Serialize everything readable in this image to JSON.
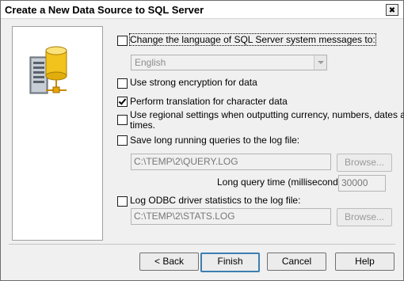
{
  "window": {
    "title": "Create a New Data Source to SQL Server",
    "close_glyph": "✖"
  },
  "options": {
    "change_language": {
      "label": "Change the language of SQL Server system messages to:",
      "checked": false
    },
    "language_select": {
      "value": "English",
      "enabled": false
    },
    "strong_encryption": {
      "label": "Use strong encryption for data",
      "checked": false
    },
    "perform_translation": {
      "label": "Perform translation for character data",
      "checked": true
    },
    "regional_settings": {
      "label_line1": "Use regional settings when outputting currency, numbers, dates and",
      "label_line2": "times.",
      "checked": false
    },
    "save_long_queries": {
      "label": "Save long running queries to the log file:",
      "checked": false,
      "path": "C:\\TEMP\\2\\QUERY.LOG",
      "browse_label": "Browse..."
    },
    "long_query_time": {
      "label": "Long query time (milliseconds):",
      "value": "30000"
    },
    "log_odbc_stats": {
      "label": "Log ODBC driver statistics to the log file:",
      "checked": false,
      "path": "C:\\TEMP\\2\\STATS.LOG",
      "browse_label": "Browse..."
    }
  },
  "footer": {
    "back_label": "< Back",
    "finish_label": "Finish",
    "cancel_label": "Cancel",
    "help_label": "Help"
  },
  "icons": {
    "side_icon": "server-database-icon"
  }
}
